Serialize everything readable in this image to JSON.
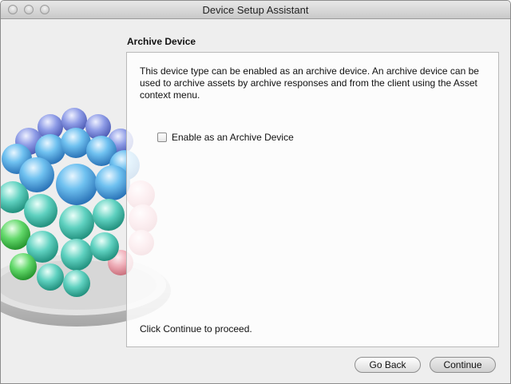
{
  "window": {
    "title": "Device Setup Assistant"
  },
  "section": {
    "title": "Archive Device"
  },
  "panel": {
    "description": "This device type can be enabled as an archive device. An archive device can be used to archive assets by archive responses and from the client using the Asset context menu.",
    "checkbox_label": "Enable as an Archive Device",
    "checkbox_checked": false,
    "footer": "Click Continue to proceed."
  },
  "buttons": {
    "back_label": "Go Back",
    "continue_label": "Continue"
  },
  "icons": {
    "art": "archive-device-spheres-icon"
  }
}
